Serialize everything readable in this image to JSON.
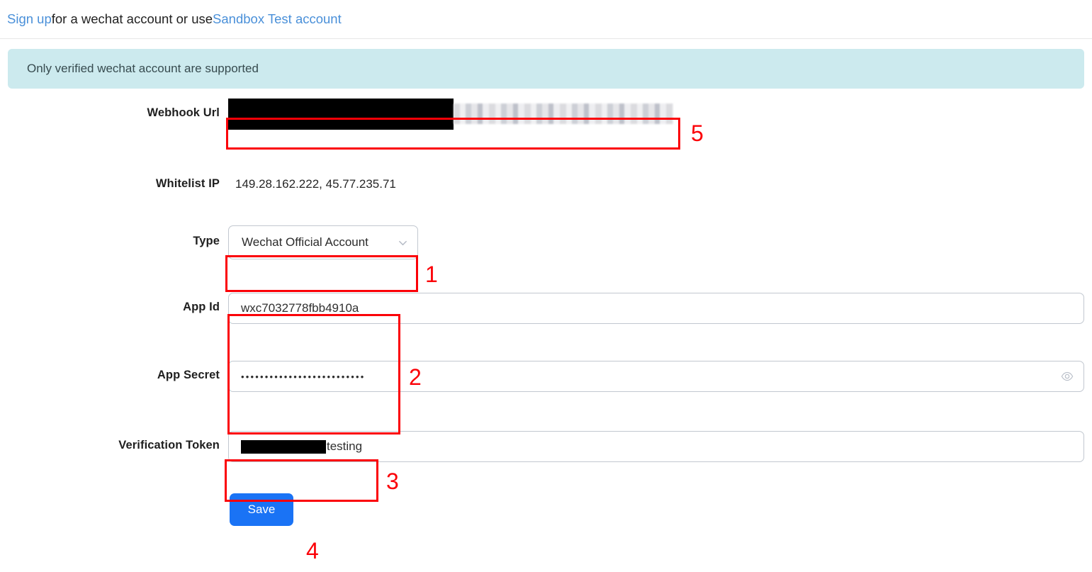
{
  "header": {
    "signup_link": "Sign up",
    "middle_text": " for a wechat account or use ",
    "sandbox_link": "Sandbox Test account"
  },
  "alert": {
    "message": "Only verified wechat account are supported"
  },
  "form": {
    "webhook": {
      "label": "Webhook Url",
      "value_redacted": "[redacted]"
    },
    "whitelist_ip": {
      "label": "Whitelist IP",
      "value": "149.28.162.222, 45.77.235.71"
    },
    "type": {
      "label": "Type",
      "selected": "Wechat Official Account",
      "icon": "chevron-down-icon"
    },
    "app_id": {
      "label": "App Id",
      "value": "wxc7032778fbb4910a"
    },
    "app_secret": {
      "label": "App Secret",
      "value": "••••••••••••••••••••••••••",
      "toggle_icon": "eye-icon"
    },
    "verification_token": {
      "label": "Verification Token",
      "value_visible": "testing"
    },
    "save_button": "Save"
  },
  "annotations": {
    "n1": "1",
    "n2": "2",
    "n3": "3",
    "n4": "4",
    "n5": "5"
  },
  "colors": {
    "link": "#4a90d9",
    "alert_bg": "#cceaee",
    "primary_button": "#1a73f5",
    "annotation_red": "#fb0007"
  }
}
